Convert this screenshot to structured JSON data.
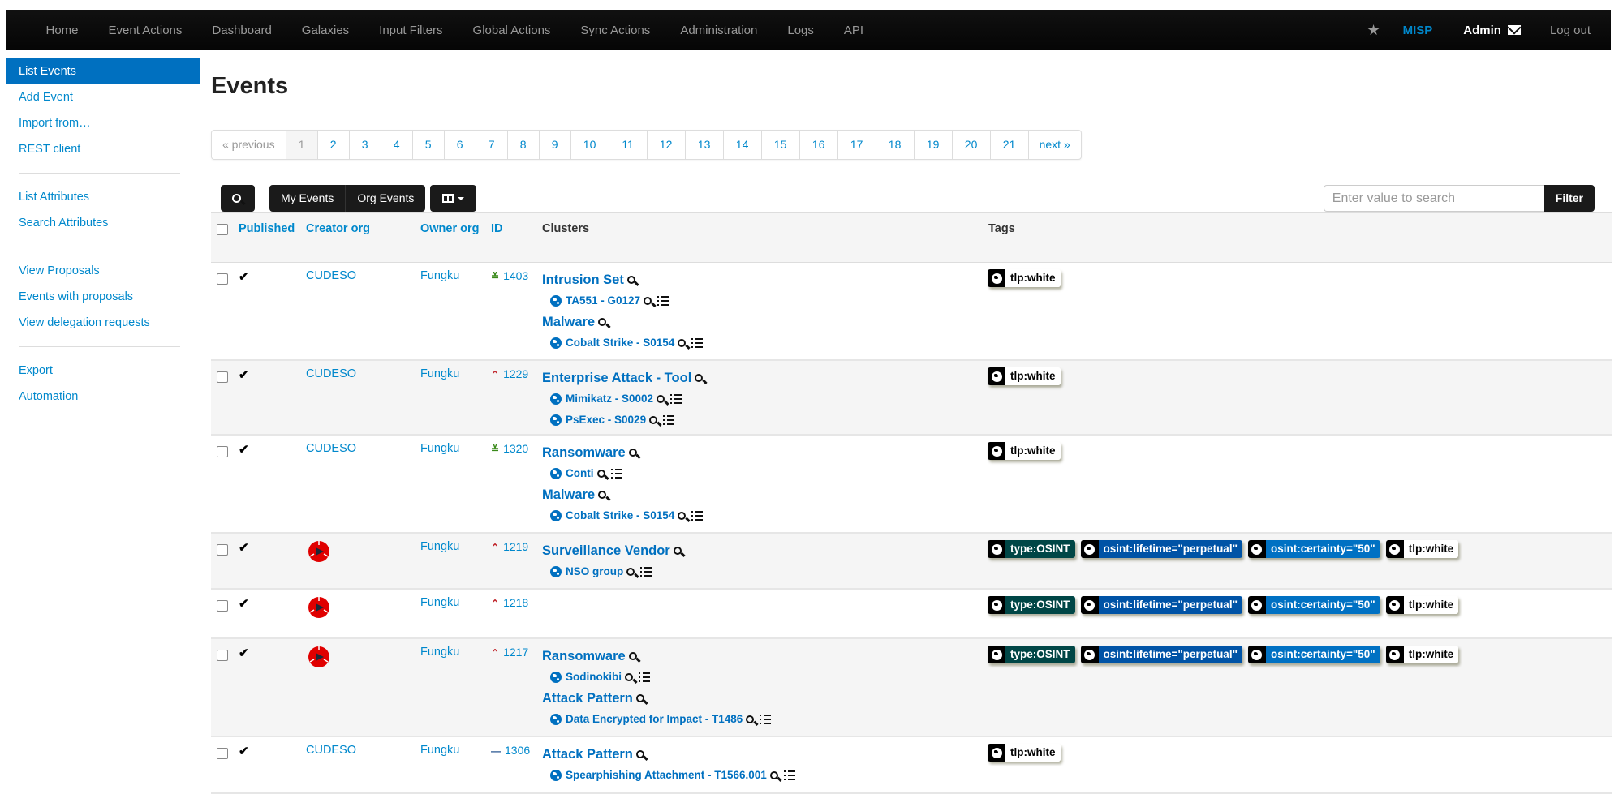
{
  "navbar": {
    "items": [
      "Home",
      "Event Actions",
      "Dashboard",
      "Galaxies",
      "Input Filters",
      "Global Actions",
      "Sync Actions",
      "Administration",
      "Logs",
      "API"
    ],
    "brand": "MISP",
    "user": "Admin",
    "logout": "Log out",
    "star_icon": "star-icon",
    "mail_icon": "envelope-icon"
  },
  "sidebar": {
    "groups": [
      [
        "List Events",
        "Add Event",
        "Import from…",
        "REST client"
      ],
      [
        "List Attributes",
        "Search Attributes"
      ],
      [
        "View Proposals",
        "Events with proposals",
        "View delegation requests"
      ],
      [
        "Export",
        "Automation"
      ]
    ],
    "active": "List Events"
  },
  "page": {
    "title": "Events"
  },
  "pagination": {
    "previous": "« previous",
    "next": "next »",
    "pages": [
      "1",
      "2",
      "3",
      "4",
      "5",
      "6",
      "7",
      "8",
      "9",
      "10",
      "11",
      "12",
      "13",
      "14",
      "15",
      "16",
      "17",
      "18",
      "19",
      "20",
      "21"
    ],
    "current": "1"
  },
  "toolbar": {
    "my_events": "My Events",
    "org_events": "Org Events",
    "search_placeholder": "Enter value to search",
    "filter": "Filter"
  },
  "table": {
    "headers": {
      "published": "Published",
      "creator_org": "Creator org",
      "owner_org": "Owner org",
      "id": "ID",
      "clusters": "Clusters",
      "tags": "Tags"
    },
    "colors": {
      "threat_low": "#3a8a1a",
      "threat_high": "#c0242a",
      "threat_undefined": "#1f4e8c",
      "tag_type_osint": "#004646",
      "tag_lifetime": "#0053a6",
      "tag_certainty": "#0071c3",
      "tag_tlp_white": "#ffffff"
    },
    "rows": [
      {
        "published": "✔",
        "creator_org": "CUDESO",
        "creator_logo": false,
        "owner_org": "Fungku",
        "threat": "low",
        "threat_symbol": "≚",
        "id": "1403",
        "clusters": [
          {
            "name": "Intrusion Set",
            "values": [
              "TA551 - G0127"
            ]
          },
          {
            "name": "Malware",
            "values": [
              "Cobalt Strike - S0154"
            ]
          }
        ],
        "tags": [
          {
            "label": "tlp:white",
            "style": "white"
          }
        ]
      },
      {
        "published": "✔",
        "creator_org": "CUDESO",
        "creator_logo": false,
        "owner_org": "Fungku",
        "threat": "high",
        "threat_symbol": "⌃",
        "id": "1229",
        "clusters": [
          {
            "name": "Enterprise Attack - Tool",
            "values": [
              "Mimikatz - S0002",
              "PsExec - S0029"
            ]
          }
        ],
        "tags": [
          {
            "label": "tlp:white",
            "style": "white"
          }
        ]
      },
      {
        "published": "✔",
        "creator_org": "CUDESO",
        "creator_logo": false,
        "owner_org": "Fungku",
        "threat": "low",
        "threat_symbol": "≚",
        "id": "1320",
        "clusters": [
          {
            "name": "Ransomware",
            "values": [
              "Conti"
            ]
          },
          {
            "name": "Malware",
            "values": [
              "Cobalt Strike - S0154"
            ]
          }
        ],
        "tags": [
          {
            "label": "tlp:white",
            "style": "white"
          }
        ]
      },
      {
        "published": "✔",
        "creator_org": "",
        "creator_logo": true,
        "owner_org": "Fungku",
        "threat": "high",
        "threat_symbol": "⌃",
        "id": "1219",
        "clusters": [
          {
            "name": "Surveillance Vendor",
            "values": [
              "NSO group"
            ]
          }
        ],
        "tags": [
          {
            "label": "type:OSINT",
            "style": "osint"
          },
          {
            "label": "osint:lifetime=\"perpetual\"",
            "style": "lifetime"
          },
          {
            "label": "osint:certainty=\"50\"",
            "style": "certainty"
          },
          {
            "label": "tlp:white",
            "style": "white"
          }
        ]
      },
      {
        "published": "✔",
        "creator_org": "",
        "creator_logo": true,
        "owner_org": "Fungku",
        "threat": "high",
        "threat_symbol": "⌃",
        "id": "1218",
        "clusters": [],
        "tags": [
          {
            "label": "type:OSINT",
            "style": "osint"
          },
          {
            "label": "osint:lifetime=\"perpetual\"",
            "style": "lifetime"
          },
          {
            "label": "osint:certainty=\"50\"",
            "style": "certainty"
          },
          {
            "label": "tlp:white",
            "style": "white"
          }
        ]
      },
      {
        "published": "✔",
        "creator_org": "",
        "creator_logo": true,
        "owner_org": "Fungku",
        "threat": "high",
        "threat_symbol": "⌃",
        "id": "1217",
        "clusters": [
          {
            "name": "Ransomware",
            "values": [
              "Sodinokibi"
            ]
          },
          {
            "name": "Attack Pattern",
            "values": [
              "Data Encrypted for Impact - T1486"
            ]
          }
        ],
        "tags": [
          {
            "label": "type:OSINT",
            "style": "osint"
          },
          {
            "label": "osint:lifetime=\"perpetual\"",
            "style": "lifetime"
          },
          {
            "label": "osint:certainty=\"50\"",
            "style": "certainty"
          },
          {
            "label": "tlp:white",
            "style": "white"
          }
        ]
      },
      {
        "published": "✔",
        "creator_org": "CUDESO",
        "creator_logo": false,
        "owner_org": "Fungku",
        "threat": "undefined",
        "threat_symbol": "—",
        "id": "1306",
        "clusters": [
          {
            "name": "Attack Pattern",
            "values": [
              "Spearphishing Attachment - T1566.001"
            ]
          }
        ],
        "tags": [
          {
            "label": "tlp:white",
            "style": "white"
          }
        ]
      }
    ]
  }
}
